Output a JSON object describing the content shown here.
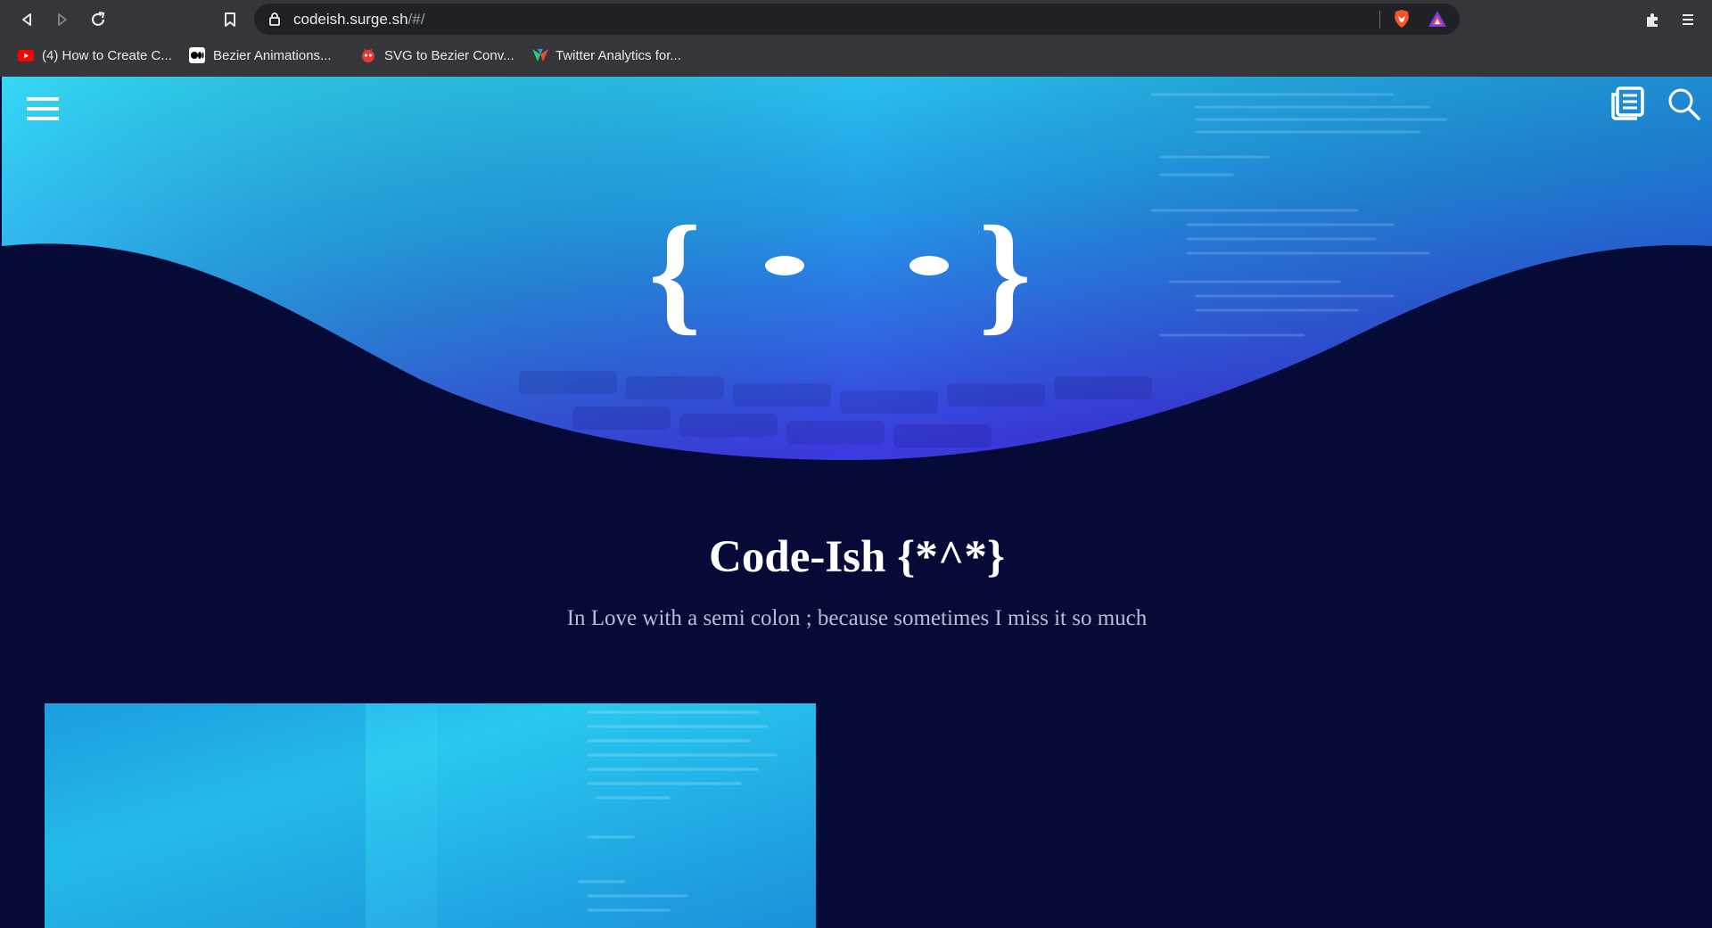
{
  "browser": {
    "url_host": "codeish.surge.sh",
    "url_path": "/#/",
    "bookmarks": [
      {
        "label": "(4) How to Create C...",
        "icon": "youtube-icon",
        "color": "#ff0000"
      },
      {
        "label": "Bezier Animations...",
        "icon": "medium-icon",
        "color": "#ffffff"
      },
      {
        "label": "SVG to Bezier Conv...",
        "icon": "svg-converter-icon",
        "color": "#e53935"
      },
      {
        "label": "Twitter Analytics for...",
        "icon": "twitter-analytics-icon",
        "color": "#2ecc71"
      }
    ]
  },
  "site": {
    "logo": "{: :}",
    "title": "Code-Ish {*^*}",
    "tagline": "In Love with a semi colon ; because sometimes I miss it so much"
  },
  "colors": {
    "page_bg": "#050a36",
    "hero_top": "#27c8ec",
    "hero_bottom": "#3a3fe0"
  }
}
